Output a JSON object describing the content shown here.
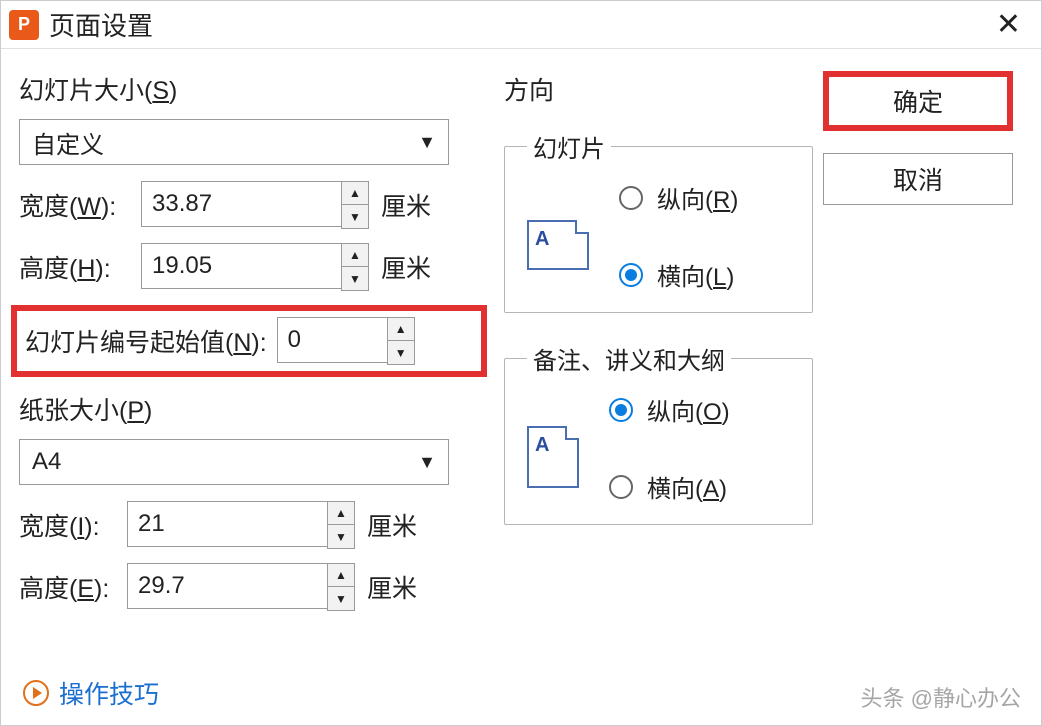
{
  "titlebar": {
    "title": "页面设置"
  },
  "slide_size": {
    "label_prefix": "幻灯片大小(",
    "label_key": "S",
    "label_suffix": ")",
    "preset": "自定义",
    "width_label_prefix": "宽度(",
    "width_key": "W",
    "width_label_suffix": "):",
    "width_value": "33.87",
    "height_label_prefix": "高度(",
    "height_key": "H",
    "height_label_suffix": "):",
    "height_value": "19.05",
    "unit": "厘米",
    "start_num_label_prefix": "幻灯片编号起始值(",
    "start_num_key": "N",
    "start_num_label_suffix": "):",
    "start_num_value": "0"
  },
  "paper_size": {
    "label_prefix": "纸张大小(",
    "label_key": "P",
    "label_suffix": ")",
    "preset": "A4",
    "width_label_prefix": "宽度(",
    "width_key": "I",
    "width_label_suffix": "):",
    "width_value": "21",
    "height_label_prefix": "高度(",
    "height_key": "E",
    "height_label_suffix": "):",
    "height_value": "29.7",
    "unit": "厘米"
  },
  "orientation": {
    "heading": "方向",
    "slides": {
      "legend": "幻灯片",
      "portrait_prefix": "纵向(",
      "portrait_key": "R",
      "portrait_suffix": ")",
      "landscape_prefix": "横向(",
      "landscape_key": "L",
      "landscape_suffix": ")",
      "selected": "landscape"
    },
    "notes": {
      "legend": "备注、讲义和大纲",
      "portrait_prefix": "纵向(",
      "portrait_key": "O",
      "portrait_suffix": ")",
      "landscape_prefix": "横向(",
      "landscape_key": "A",
      "landscape_suffix": ")",
      "selected": "portrait"
    }
  },
  "buttons": {
    "ok": "确定",
    "cancel": "取消"
  },
  "tips": {
    "label": "操作技巧"
  },
  "watermark": "头条 @静心办公"
}
